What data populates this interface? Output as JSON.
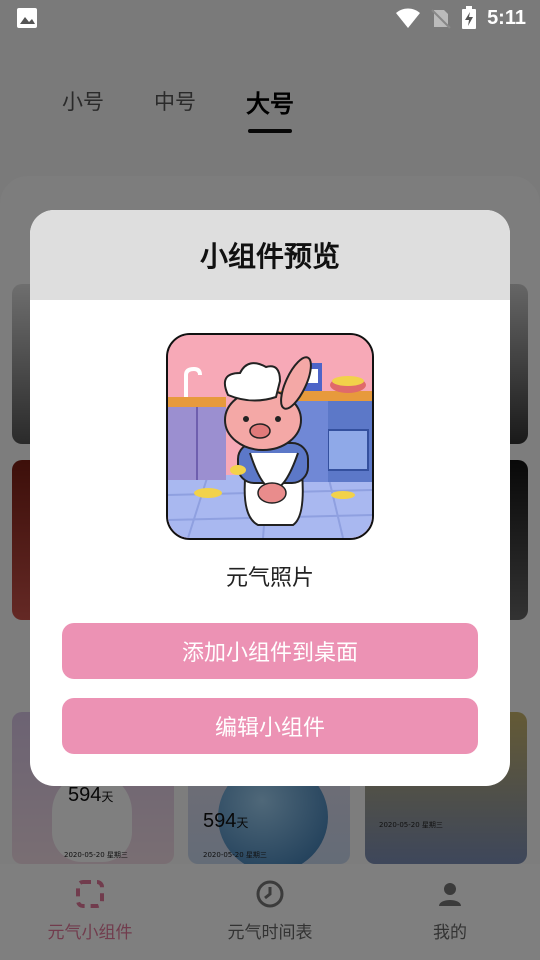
{
  "status_bar": {
    "time": "5:11",
    "icons": [
      "image-icon",
      "wifi-icon",
      "no-sim-icon",
      "battery-charging-icon"
    ]
  },
  "size_tabs": [
    {
      "label": "小号",
      "active": false
    },
    {
      "label": "中号",
      "active": false
    },
    {
      "label": "大号",
      "active": true
    }
  ],
  "bottom_cards": [
    {
      "days": "594",
      "unit": "天",
      "date": "2020-05-20 星期三"
    },
    {
      "days": "594",
      "unit": "天",
      "date": "2020-05-20 星期三"
    },
    {
      "days": "",
      "unit": "",
      "date": "2020-05-20 星期三"
    }
  ],
  "bottom_nav": [
    {
      "label": "元气小组件",
      "icon": "widget-icon",
      "active": true
    },
    {
      "label": "元气时间表",
      "icon": "clock-icon",
      "active": false
    },
    {
      "label": "我的",
      "icon": "user-icon",
      "active": false
    }
  ],
  "dialog": {
    "title": "小组件预览",
    "preview_caption": "元气照片",
    "add_button": "添加小组件到桌面",
    "edit_button": "编辑小组件"
  },
  "colors": {
    "accent": "#ec92b4",
    "nav_active": "#e2789a",
    "dialog_header": "#dedede"
  }
}
